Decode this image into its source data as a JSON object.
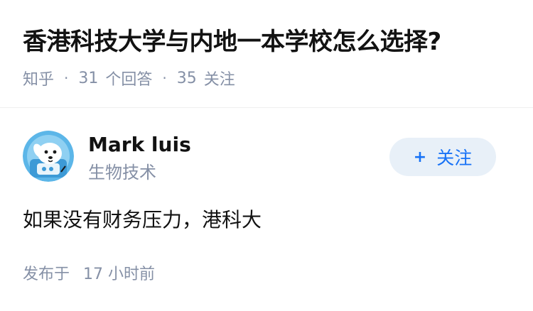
{
  "question": {
    "title": "香港科技大学与内地一本学校怎么选择?",
    "source": "知乎",
    "answer_count": "31",
    "answer_label": "个回答",
    "follow_count": "35",
    "follow_label": "关注",
    "separator": "·"
  },
  "answer": {
    "author": {
      "name": "Mark luis",
      "bio": "生物技术",
      "avatar_icon": "cartoon-dog-astronaut-avatar"
    },
    "follow_button": {
      "icon": "+",
      "label": "关注"
    },
    "content": "如果没有财务压力，港科大",
    "publish_label": "发布于",
    "publish_time": "17 小时前"
  },
  "colors": {
    "primary_text": "#121212",
    "secondary_text": "#8590a6",
    "accent": "#1772f6",
    "button_bg": "#e8f0f8"
  }
}
